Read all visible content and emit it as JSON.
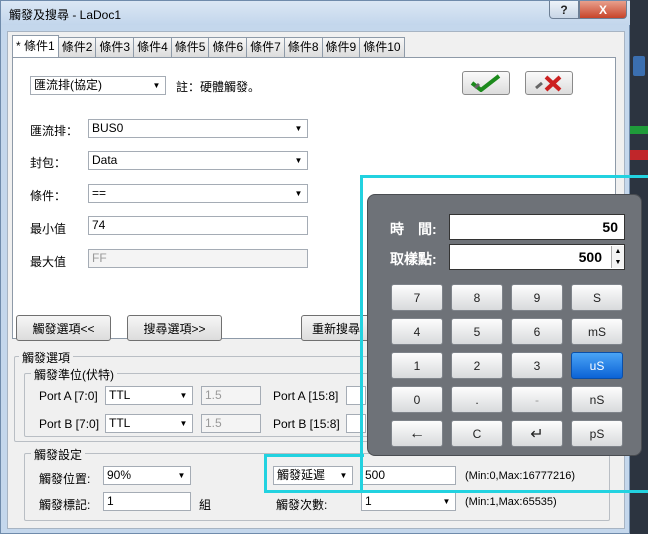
{
  "window": {
    "title": "觸發及搜尋 - LaDoc1",
    "help_label": "?",
    "close_label": "X"
  },
  "tabs": [
    "* 條件1",
    "條件2",
    "條件3",
    "條件4",
    "條件5",
    "條件6",
    "條件7",
    "條件8",
    "條件9",
    "條件10"
  ],
  "condition": {
    "mode_value": "匯流排(協定)",
    "note": "註：硬體觸發。",
    "bus_label": "匯流排：",
    "bus_value": "BUS0",
    "packet_label": "封包：",
    "packet_value": "Data",
    "cond_label": "條件：",
    "cond_value": "==",
    "min_label": "最小值",
    "min_value": "74",
    "max_label": "最大值",
    "max_value": "FF"
  },
  "buttons": {
    "trigger_options": "觸發選項<<",
    "search_options": "搜尋選項>>",
    "research": "重新搜尋"
  },
  "trigger_options": {
    "group_title": "觸發選項",
    "level_title": "觸發準位(伏特)",
    "portA70_label": "Port A  [7:0]",
    "portA70_value": "TTL",
    "portA70_volt": "1.5",
    "portA158_label": "Port A [15:8]",
    "portB70_label": "Port B  [7:0]",
    "portB70_value": "TTL",
    "portB70_volt": "1.5",
    "portB158_label": "Port B [15:8]"
  },
  "trigger_settings": {
    "group_title": "觸發設定",
    "position_label": "觸發位置:",
    "position_value": "90%",
    "mark_label": "觸發標記:",
    "mark_value": "1",
    "mark_unit": "組",
    "delay_select": "觸發延遲",
    "delay_value": "500",
    "delay_range": "(Min:0,Max:16777216)",
    "count_label": "觸發次數:",
    "count_value": "1",
    "count_range": "(Min:1,Max:65535)"
  },
  "calculator": {
    "time_label": "時　間:",
    "time_value": "50",
    "samples_label": "取樣點:",
    "samples_value": "500",
    "keys": [
      [
        "7",
        "8",
        "9",
        "S"
      ],
      [
        "4",
        "5",
        "6",
        "mS"
      ],
      [
        "1",
        "2",
        "3",
        "uS"
      ],
      [
        "0",
        ".",
        "-",
        "nS"
      ],
      [
        "←",
        "C",
        "↵",
        "pS"
      ]
    ],
    "selected_key": "uS"
  },
  "colors": {
    "highlight": "#22d2e0",
    "selected_unit": "#1a73e8",
    "title_bar": "#c3d6ec"
  }
}
